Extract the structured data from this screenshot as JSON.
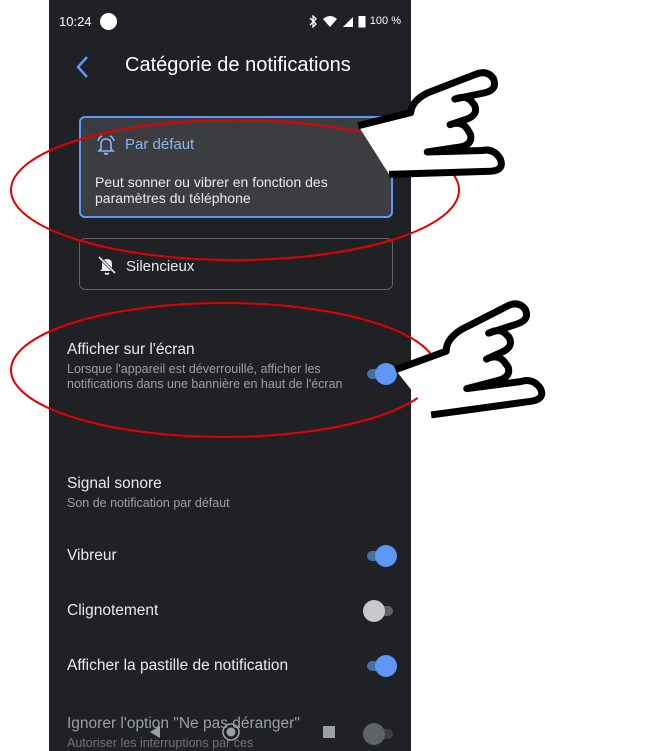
{
  "status_bar": {
    "time": "10:24",
    "battery": "100 %"
  },
  "header": {
    "title": "Catégorie de notifications"
  },
  "importance": {
    "default": {
      "title": "Par défaut",
      "description": "Peut sonner ou vibrer en fonction des paramètres du téléphone",
      "selected": true
    },
    "silent": {
      "title": "Silencieux",
      "selected": false
    }
  },
  "settings": [
    {
      "title": "Afficher sur l'écran",
      "subtitle": "Lorsque l'appareil est déverrouillé, afficher les notifications dans une bannière en haut de l'écran",
      "toggle": true
    },
    {
      "title": "Signal sonore",
      "subtitle": "Son de notification par défaut"
    },
    {
      "title": "Vibreur",
      "toggle": true
    },
    {
      "title": "Clignotement",
      "toggle": false
    },
    {
      "title": "Afficher la pastille de notification",
      "toggle": true
    },
    {
      "title": "Ignorer l'option \"Ne pas déranger\"",
      "subtitle": "Autoriser les interruptions par ces",
      "toggle": false
    }
  ],
  "colors": {
    "background": "#202124",
    "accent": "#5e97f6",
    "annotation": "#e00000"
  },
  "icons": {
    "back": "chevron-left-icon",
    "default": "bell-ringing-icon",
    "silent": "bell-off-icon"
  }
}
